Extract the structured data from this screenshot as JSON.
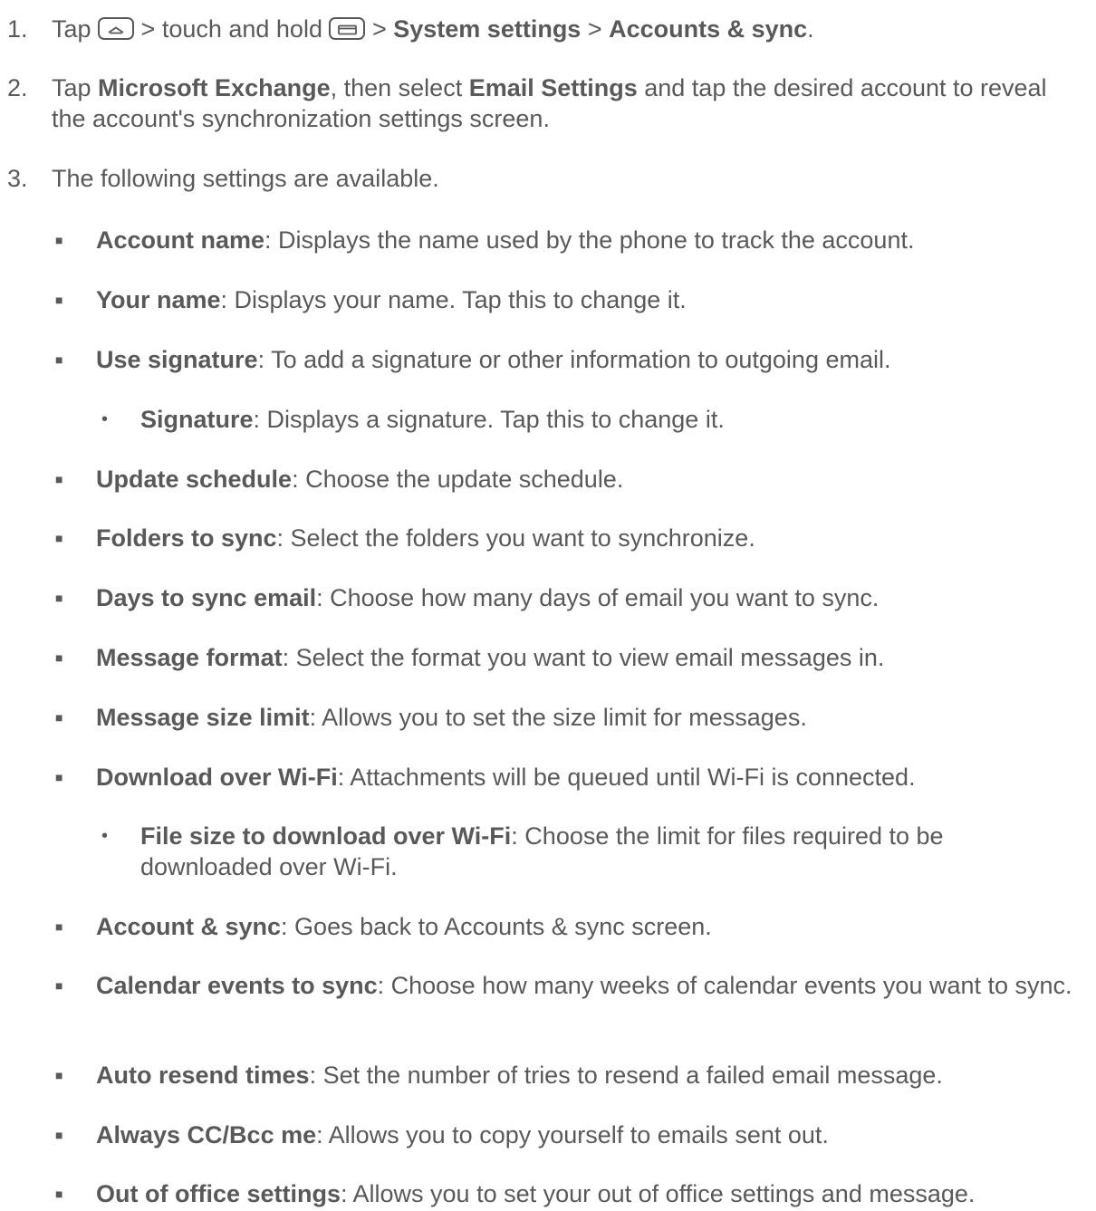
{
  "steps": [
    {
      "number": "1.",
      "t1": "Tap ",
      "t2": " > touch and hold ",
      "t3": " > ",
      "b1": "System settings",
      "t4": " > ",
      "b2": "Accounts & sync",
      "t5": ".",
      "icons": [
        "home-key-icon",
        "menu-key-icon"
      ]
    },
    {
      "number": "2.",
      "t1": "Tap ",
      "b1": "Microsoft Exchange",
      "t2": ", then select ",
      "b2": "Email Settings",
      "t3": " and tap the desired account to reveal the account's synchronization settings screen."
    },
    {
      "number": "3.",
      "t1": "The following settings are available."
    }
  ],
  "settings": [
    {
      "term": "Account name",
      "desc": ": Displays the name used by the phone to track the account."
    },
    {
      "term": "Your name",
      "desc": ": Displays your name. Tap this to change it."
    },
    {
      "term": "Use signature",
      "desc": ": To add a signature or other information to outgoing email."
    },
    {
      "term": "Signature",
      "desc": ": Displays a signature. Tap this to change it."
    },
    {
      "term": "Update schedule",
      "desc": ": Choose the update schedule."
    },
    {
      "term": "Folders to sync",
      "desc": ": Select the folders you want to synchronize."
    },
    {
      "term": "Days to sync email",
      "desc": ": Choose how many days of email you want to sync."
    },
    {
      "term": "Message format",
      "desc": ": Select the format you want to view email messages in."
    },
    {
      "term": "Message size limit",
      "desc": ": Allows you to set the size limit for messages."
    },
    {
      "term": "Download over Wi-Fi",
      "desc": ": Attachments will be queued until Wi-Fi is connected."
    },
    {
      "term": "File size to download over Wi-Fi",
      "desc": ": Choose the limit for files required to be downloaded over Wi-Fi."
    },
    {
      "term": "Account & sync",
      "desc": ": Goes back to Accounts & sync screen."
    },
    {
      "term": "Calendar events to sync",
      "desc": ": Choose how many weeks of calendar events you want to sync."
    },
    {
      "term": "Auto resend times",
      "desc": ": Set the number of tries to resend a failed email message."
    },
    {
      "term": "Always CC/Bcc me",
      "desc": ": Allows you to copy yourself to emails sent out."
    },
    {
      "term": "Out of office settings",
      "desc": ": Allows you to set your out of office settings and message."
    }
  ],
  "marks": {
    "square": "■",
    "dot": "•"
  }
}
